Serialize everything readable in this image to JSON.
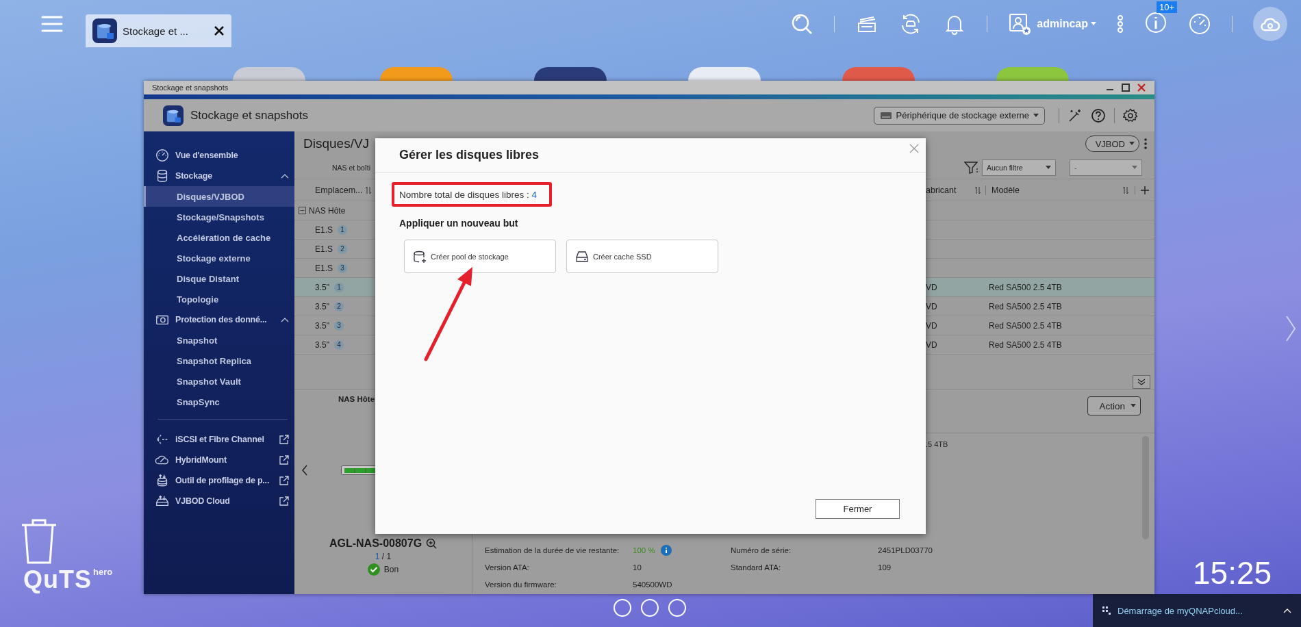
{
  "topbar": {
    "tab": {
      "label": "Stockage et ..."
    },
    "user": "admincap",
    "badge": "10+"
  },
  "window": {
    "title": "Stockage et snapshots",
    "app_title": "Stockage et snapshots",
    "device_dropdown": "Périphérique de stockage externe"
  },
  "sidebar": {
    "items": [
      {
        "label": "Vue d'ensemble"
      },
      {
        "label": "Stockage",
        "expanded": true,
        "children": [
          {
            "label": "Disques/VJBOD",
            "selected": true
          },
          {
            "label": "Stockage/Snapshots",
            "selected": false
          },
          {
            "label": "Accélération de cache",
            "selected": false
          },
          {
            "label": "Stockage externe",
            "selected": false
          },
          {
            "label": "Disque Distant",
            "selected": false
          },
          {
            "label": "Topologie",
            "selected": false
          }
        ]
      },
      {
        "label": "Protection des donné...",
        "expanded": true,
        "children": [
          {
            "label": "Snapshot",
            "selected": false
          },
          {
            "label": "Snapshot Replica",
            "selected": false
          },
          {
            "label": "Snapshot Vault",
            "selected": false
          },
          {
            "label": "SnapSync",
            "selected": false
          }
        ]
      }
    ],
    "links": [
      {
        "label": "iSCSI et Fibre Channel"
      },
      {
        "label": "HybridMount"
      },
      {
        "label": "Outil de profilage de p..."
      },
      {
        "label": "VJBOD Cloud"
      }
    ]
  },
  "content": {
    "heading": "Disques/VJ",
    "vjbod_button": "VJBOD",
    "subtab": "NAS et boîti",
    "filter": "Aucun filtre",
    "filter_2": "-",
    "table": {
      "columns": [
        {
          "label": "Emplacem..."
        },
        {
          "label": "abricant"
        },
        {
          "label": "Modèle"
        }
      ],
      "group": {
        "label": "NAS Hôte",
        "expanded": true
      },
      "rows": [
        {
          "slot": "E1.S",
          "number": "1",
          "selected": false
        },
        {
          "slot": "E1.S",
          "number": "2",
          "selected": false
        },
        {
          "slot": "E1.S",
          "number": "3",
          "selected": false
        },
        {
          "slot": "3.5\"",
          "number": "1",
          "manufacturer": "VD",
          "model": "Red SA500 2.5 4TB",
          "selected": true
        },
        {
          "slot": "3.5\"",
          "number": "2",
          "manufacturer": "VD",
          "model": "Red SA500 2.5 4TB",
          "selected": false
        },
        {
          "slot": "3.5\"",
          "number": "3",
          "manufacturer": "VD",
          "model": "Red SA500 2.5 4TB",
          "selected": false
        },
        {
          "slot": "3.5\"",
          "number": "4",
          "manufacturer": "VD",
          "model": "Red SA500 2.5 4TB",
          "selected": false
        }
      ]
    },
    "panel": {
      "label": "NAS Hôte",
      "device_name": "AGL-NAS-00807G",
      "page_current": "1",
      "page_rest": "/ 1",
      "status": "Bon",
      "action": "Action",
      "model_fragment": ".5 4TB",
      "details": [
        [
          {
            "label": "Estimation de la durée de vie restante:",
            "value": "100 %",
            "kind": "health"
          },
          {
            "label": "Numéro de série:",
            "value": "2451PLD03770",
            "kind": "text"
          }
        ],
        [
          {
            "label": "Version ATA:",
            "value": "10",
            "kind": "text"
          },
          {
            "label": "Standard ATA:",
            "value": "109",
            "kind": "text"
          }
        ],
        [
          {
            "label": "Version du firmware:",
            "value": "540500WD",
            "kind": "text"
          }
        ]
      ]
    }
  },
  "dialog": {
    "title": "Gérer les disques libres",
    "count_label": "Nombre total de disques libres :",
    "count": "4",
    "section_title": "Appliquer un nouveau but",
    "options": [
      {
        "label": "Créer pool de stockage"
      },
      {
        "label": "Créer cache SSD"
      }
    ],
    "close_button": "Fermer"
  },
  "desktop": {
    "logo": "QuTS",
    "logo_edition": "hero",
    "clock": "15:25",
    "notification": "Démarrage de myQNAPcloud..."
  }
}
